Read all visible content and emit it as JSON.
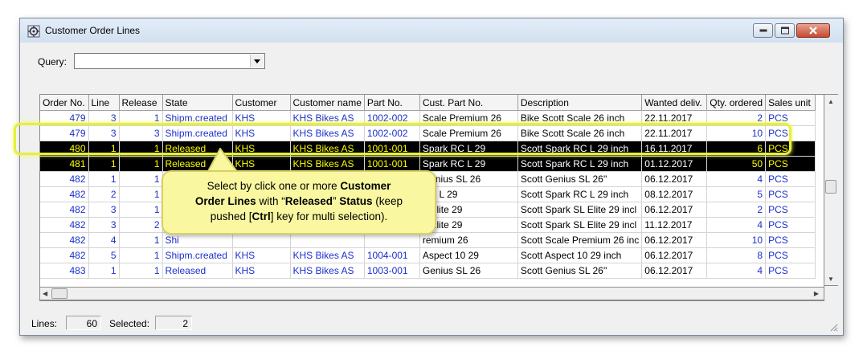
{
  "window": {
    "title": "Customer Order Lines"
  },
  "query": {
    "label": "Query:",
    "value": ""
  },
  "table": {
    "columns": [
      "Order No.",
      "Line",
      "Release",
      "State",
      "Customer",
      "Customer name",
      "Part No.",
      "Cust. Part No.",
      "Description",
      "Wanted deliv.",
      "Qty. ordered",
      "Sales unit"
    ],
    "rows": [
      [
        "479",
        "3",
        "1",
        "Shipm.created",
        "KHS",
        "KHS Bikes AS",
        "1002-002",
        "Scale Premium 26",
        "Bike Scott Scale 26 inch",
        "22.11.2017",
        "2",
        "PCS"
      ],
      [
        "479",
        "3",
        "3",
        "Shipm.created",
        "KHS",
        "KHS Bikes AS",
        "1002-002",
        "Scale Premium 26",
        "Bike Scott Scale 26 inch",
        "22.11.2017",
        "10",
        "PCS"
      ],
      [
        "480",
        "1",
        "1",
        "Released",
        "KHS",
        "KHS Bikes AS",
        "1001-001",
        "Spark RC L 29",
        "Scott Spark RC L 29 inch",
        "16.11.2017",
        "6",
        "PCS"
      ],
      [
        "481",
        "1",
        "1",
        "Released",
        "KHS",
        "KHS Bikes AS",
        "1001-001",
        "Spark RC L 29",
        "Scott Spark RC L 29 inch",
        "01.12.2017",
        "50",
        "PCS"
      ],
      [
        "482",
        "1",
        "1",
        "Shipm.created",
        "KHS",
        "KHS Bikes AS",
        "1003-001",
        "Genius SL 26",
        "Scott Genius SL 26''",
        "06.12.2017",
        "4",
        "PCS"
      ],
      [
        "482",
        "2",
        "1",
        "Shi",
        "",
        "",
        "",
        "RC L 29",
        "Scott Spark RC L 29 inch",
        "08.12.2017",
        "5",
        "PCS"
      ],
      [
        "482",
        "3",
        "1",
        "Shi",
        "",
        "",
        "",
        "L Elite 29",
        "Scott Spark SL Elite 29 incl",
        "06.12.2017",
        "2",
        "PCS"
      ],
      [
        "482",
        "3",
        "2",
        "Shi",
        "",
        "",
        "",
        "L Elite 29",
        "Scott Spark SL Elite 29 incl",
        "11.12.2017",
        "4",
        "PCS"
      ],
      [
        "482",
        "4",
        "1",
        "Shi",
        "",
        "",
        "",
        "remium 26",
        "Scott Scale Premium 26 inc",
        "06.12.2017",
        "10",
        "PCS"
      ],
      [
        "482",
        "5",
        "1",
        "Shipm.created",
        "KHS",
        "KHS Bikes AS",
        "1004-001",
        "Aspect 10 29",
        "Scott Aspect 10 29 inch",
        "06.12.2017",
        "8",
        "PCS"
      ],
      [
        "483",
        "1",
        "1",
        "Released",
        "KHS",
        "KHS Bikes AS",
        "1003-001",
        "Genius SL 26",
        "Scott Genius SL 26''",
        "06.12.2017",
        "4",
        "PCS"
      ]
    ],
    "selected_rows": [
      2,
      3
    ]
  },
  "callout": {
    "line1_a": "Select by click one or more ",
    "line1_b": "Customer",
    "line2_a": "Order Lines",
    "line2_b": " with “",
    "line2_c": "Released",
    "line2_d": "” ",
    "line2_e": "Status",
    "line2_f": " (keep",
    "line3_a": "pushed [",
    "line3_b": "Ctrl",
    "line3_c": "] key for multi selection)."
  },
  "status": {
    "lines_label": "Lines:",
    "lines_value": "60",
    "selected_label": "Selected:",
    "selected_value": "2"
  },
  "colors": {
    "link": "#1a2fcc",
    "selected_bg": "#000000",
    "selected_link": "#ffff00",
    "highlight": "#e5f03a",
    "callout_bg": "#f9f7a0"
  },
  "icons": [
    "app-icon",
    "minimize-icon",
    "maximize-icon",
    "close-icon",
    "dropdown-arrow-icon",
    "scroll-up-icon",
    "scroll-down-icon",
    "scroll-left-icon",
    "scroll-right-icon",
    "resize-grip-icon"
  ]
}
